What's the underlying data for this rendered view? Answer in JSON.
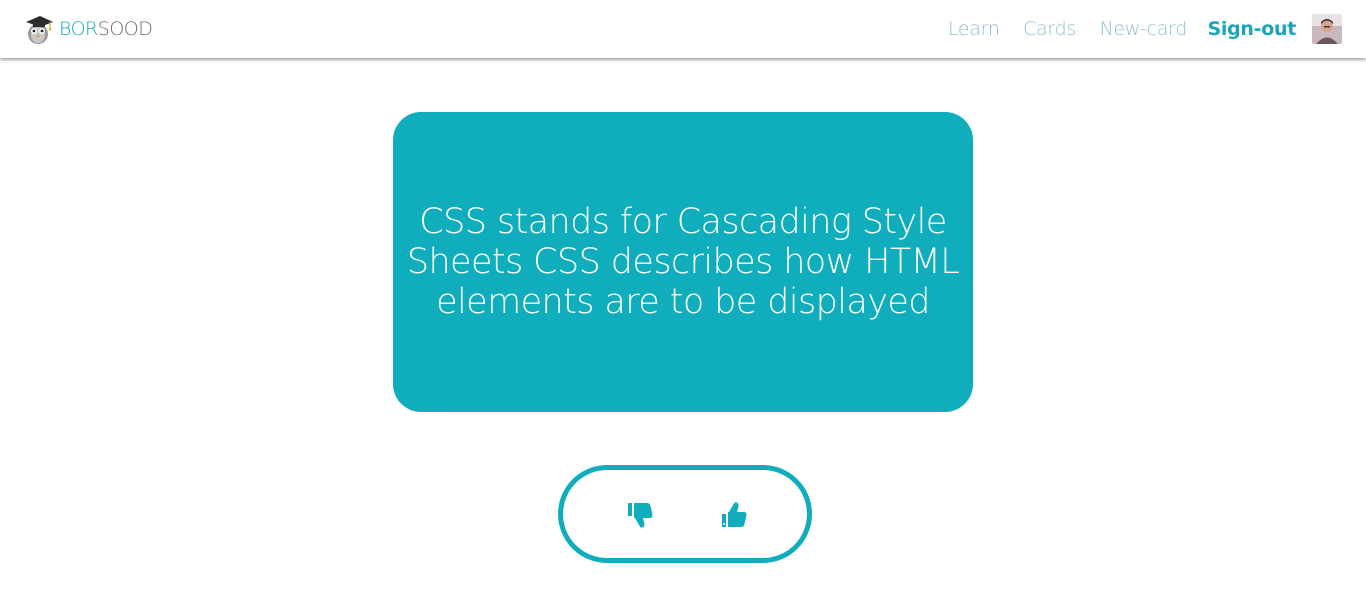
{
  "brand": {
    "part1": "BOR",
    "part2": "SOOD",
    "logo_icon": "graduation-owl-icon",
    "color_primary": "#1aa5b8",
    "color_secondary": "#6b6b6b"
  },
  "nav": {
    "items": [
      {
        "label": "Learn",
        "dot": "·"
      },
      {
        "label": "Cards",
        "dot": "·"
      },
      {
        "label": "New-card",
        "dot": "·"
      }
    ],
    "signout": "Sign-out",
    "avatar_icon": "user-avatar"
  },
  "card": {
    "text": "CSS stands for Cascading Style Sheets CSS describes how HTML elements are to be displayed",
    "color": "#10aebd"
  },
  "vote": {
    "down_icon": "thumbs-down-icon",
    "up_icon": "thumbs-up-icon",
    "color": "#10aebd"
  }
}
